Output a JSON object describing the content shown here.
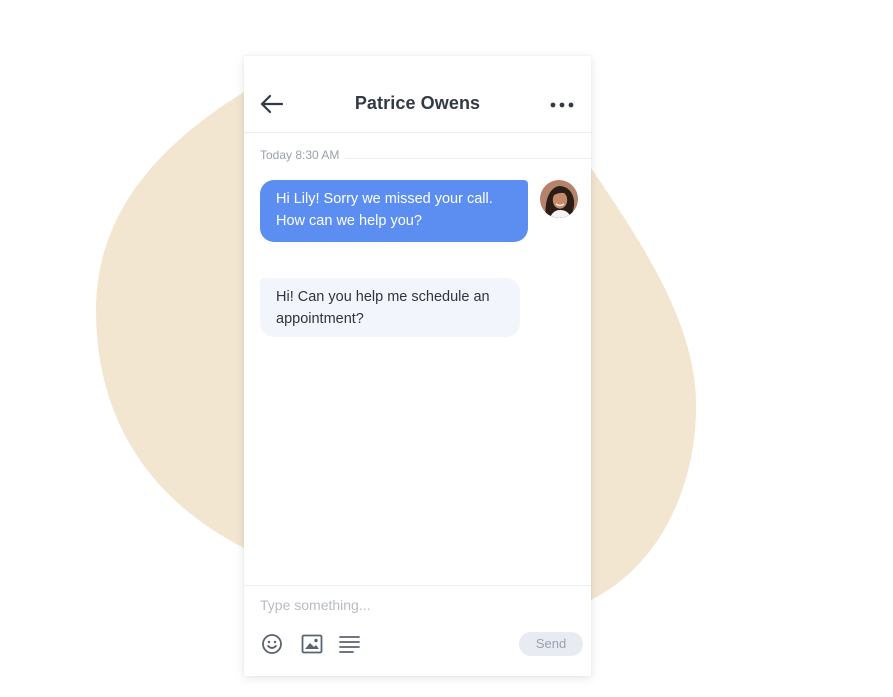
{
  "conversation": {
    "title": "Patrice Owens",
    "timestamp": "Today 8:30 AM"
  },
  "messages": [
    {
      "direction": "outgoing",
      "text": "Hi Lily! Sorry we missed your call. How can we help you?"
    },
    {
      "direction": "incoming",
      "text": "Hi! Can you help me schedule an appointment?"
    }
  ],
  "composer": {
    "placeholder": "Type something...",
    "send_label": "Send"
  },
  "icons": {
    "back": "arrow-left-icon",
    "more": "more-horizontal-icon",
    "emoji": "smiley-icon",
    "image": "image-icon",
    "template": "text-lines-icon"
  },
  "colors": {
    "backdrop_blob": "#f3e6d1",
    "outgoing_bubble": "#5c8ef2",
    "incoming_bubble": "#f2f5fb",
    "send_button": "#e8ebf2"
  }
}
